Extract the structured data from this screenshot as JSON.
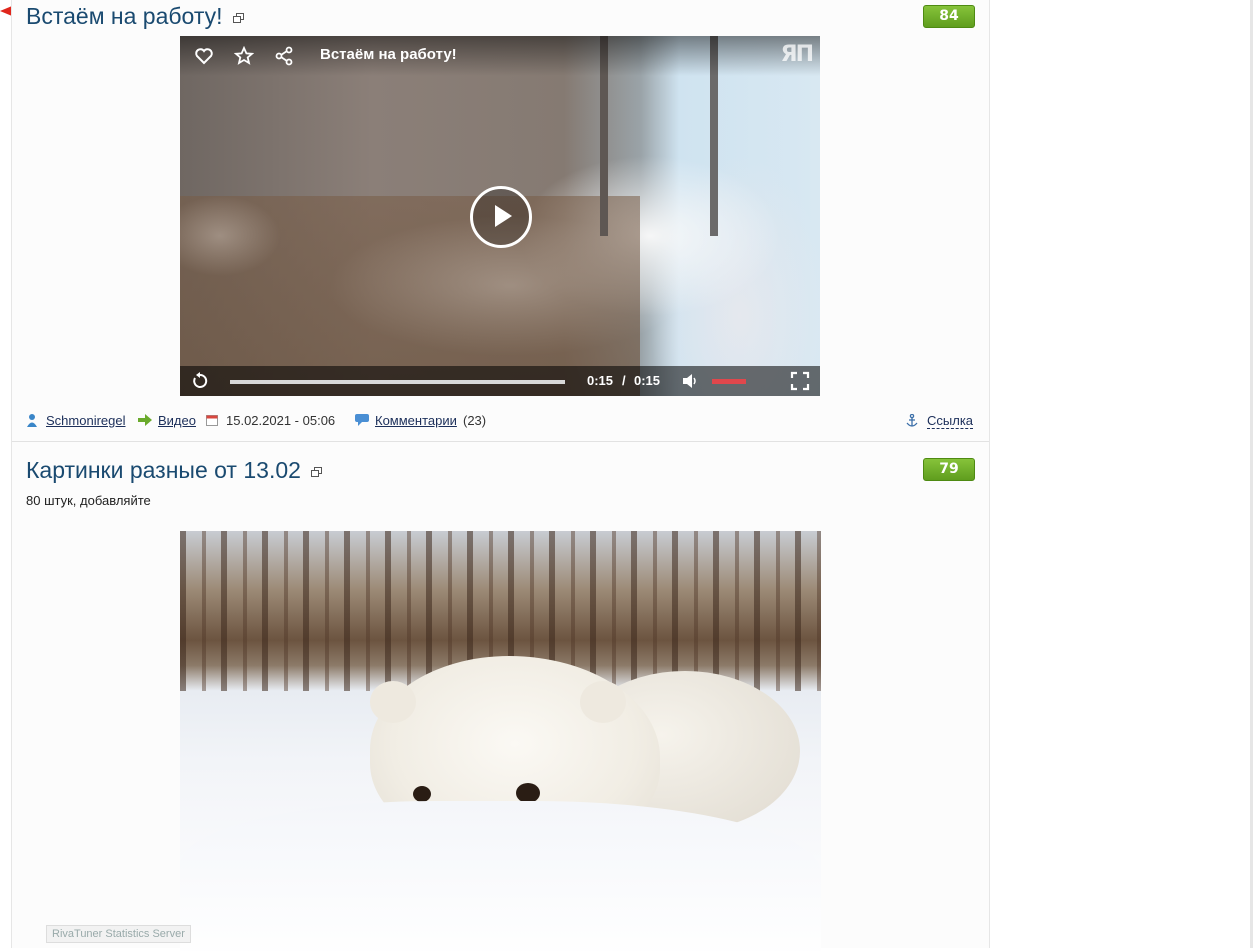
{
  "posts": [
    {
      "title": "Встаём на работу!",
      "rating": "84",
      "video": {
        "title": "Встаём на работу!",
        "logo": "ЯП",
        "current_time": "0:15",
        "separator": "/",
        "duration": "0:15",
        "progress_fraction": 1.0
      },
      "meta": {
        "author": "Schmoniregel",
        "category": "Видео",
        "date": "15.02.2021 - 05:06",
        "comments_label": "Комментарии",
        "comments_count": "(23)",
        "link_label": "Ссылка"
      }
    },
    {
      "title": "Картинки разные от 13.02",
      "rating": "79",
      "description": "80 штук, добавляйте"
    }
  ],
  "overlay_tooltip": "RivaTuner Statistics Server",
  "icons": {
    "author": "user-icon",
    "category": "arrow-right-icon",
    "date": "calendar-icon",
    "comments": "comment-icon",
    "link": "anchor-icon",
    "external": "external-window-icon"
  },
  "colors": {
    "title": "#1a4a70",
    "rating_bg": "#6fb02a",
    "video_volume": "#e0474c"
  }
}
